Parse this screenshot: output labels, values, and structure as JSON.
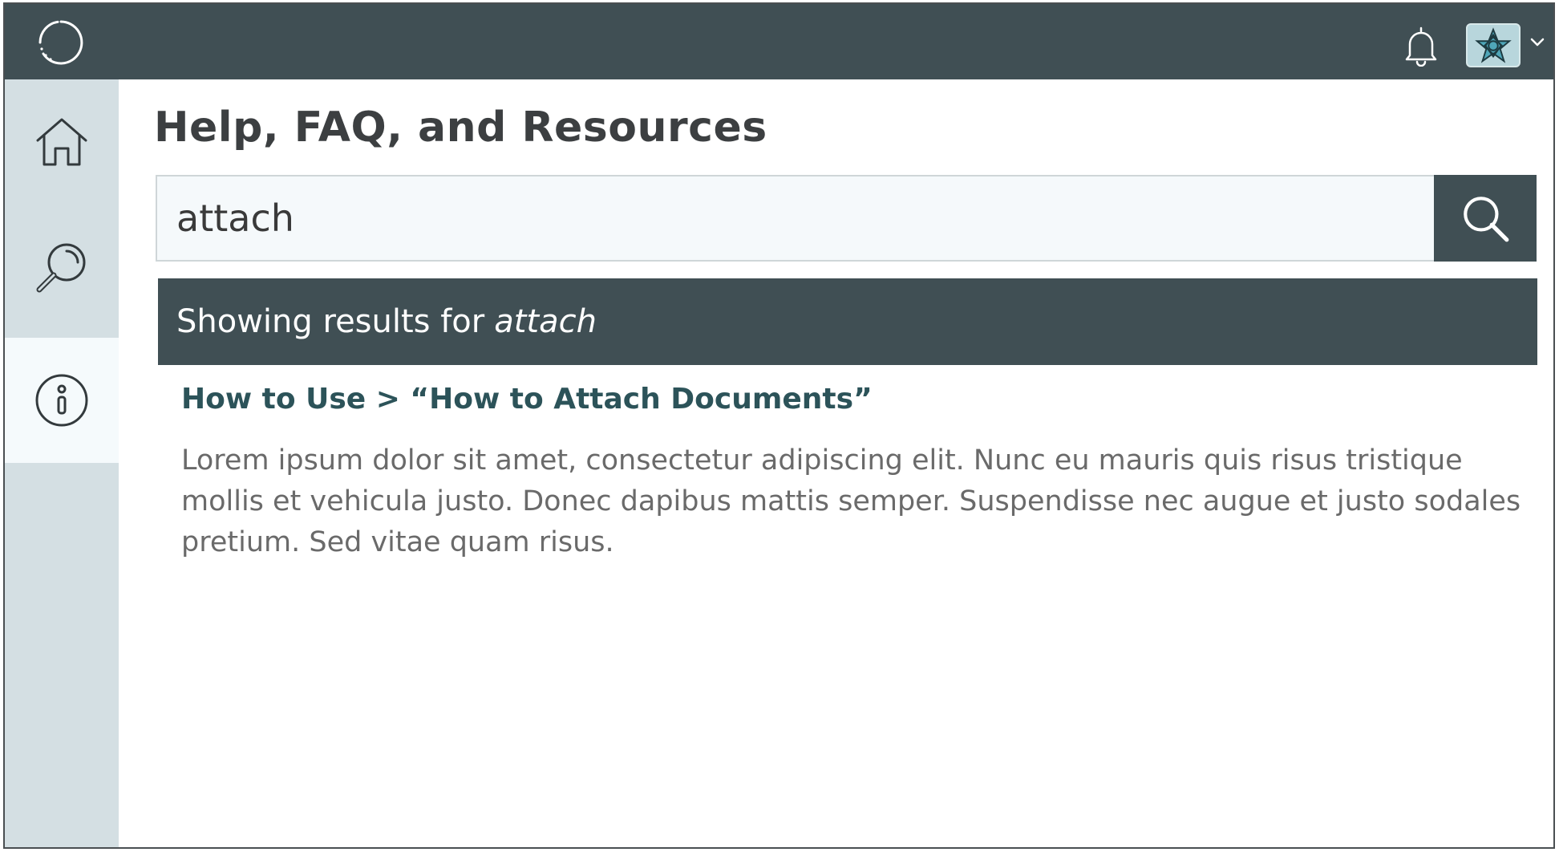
{
  "header": {
    "logo_icon": "loading-circle-logo",
    "notifications_icon": "bell-icon",
    "avatar_icon": "geometric-star-avatar",
    "avatar_menu_icon": "chevron-down-icon"
  },
  "sidebar": {
    "items": [
      {
        "icon": "home-icon",
        "active": false
      },
      {
        "icon": "search-icon",
        "active": false
      },
      {
        "icon": "info-icon",
        "active": true
      }
    ]
  },
  "main": {
    "title": "Help, FAQ, and Resources",
    "search": {
      "value": "attach",
      "button_icon": "search-icon"
    },
    "results_banner": {
      "prefix": "Showing results for",
      "query": "attach"
    },
    "results": [
      {
        "link": "How to Use > “How to Attach Documents”",
        "snippet": "Lorem ipsum dolor sit amet, consectetur adipiscing elit. Nunc eu mauris quis risus tristique mollis et vehicula justo. Donec dapibus mattis semper. Suspendisse nec augue et justo sodales pretium. Sed vitae quam risus."
      }
    ]
  },
  "colors": {
    "header_bg": "#404f54",
    "sidebar_bg": "#d4dfe3",
    "sidebar_active_bg": "#f5fafc",
    "link": "#2c5359",
    "search_bg": "#f5f9fb"
  }
}
